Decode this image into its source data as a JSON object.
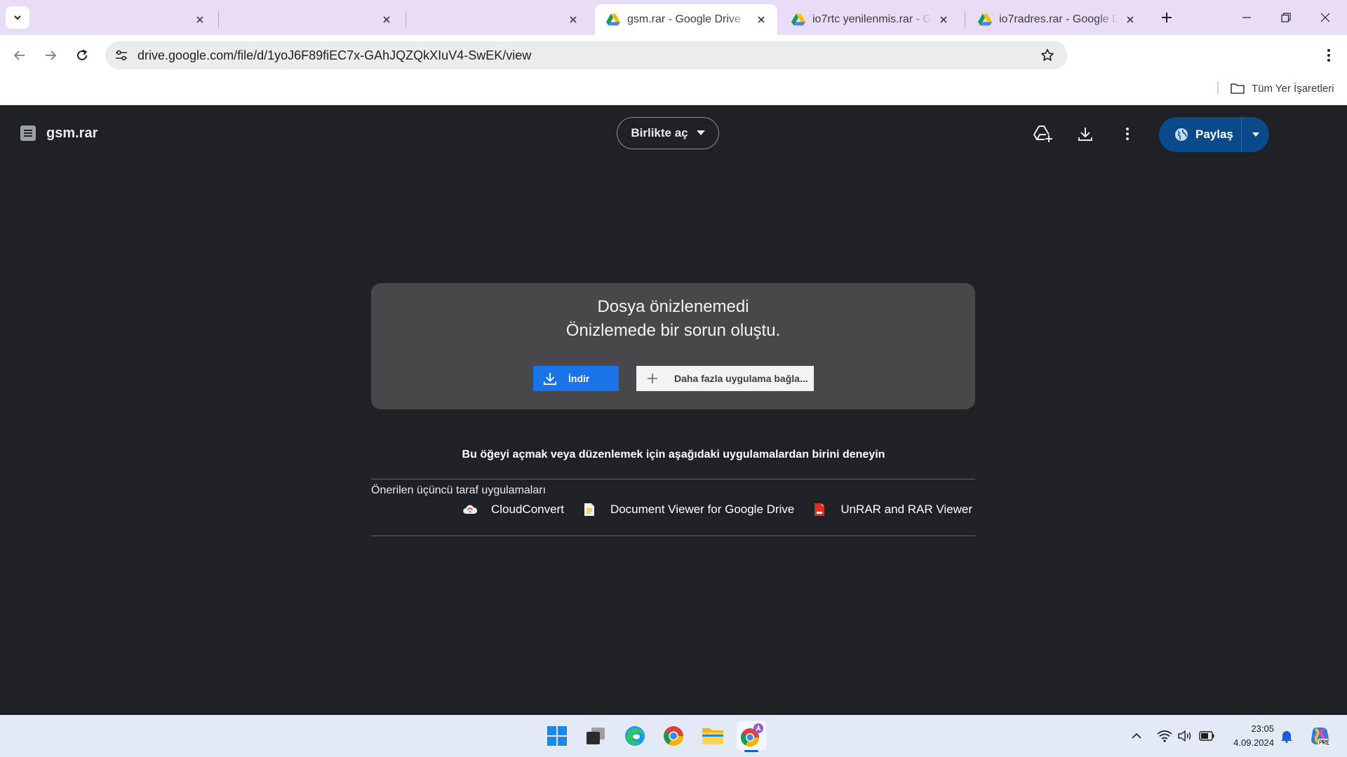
{
  "browser": {
    "tabs": [
      {
        "title": "",
        "active": false,
        "favicon": "none"
      },
      {
        "title": "",
        "active": false,
        "favicon": "none"
      },
      {
        "title": "",
        "active": false,
        "favicon": "none"
      },
      {
        "title": "gsm.rar - Google Drive",
        "active": true,
        "favicon": "google-drive-icon"
      },
      {
        "title": "io7rtc yenilenmis.rar - Google Drive",
        "active": false,
        "favicon": "google-drive-icon"
      },
      {
        "title": "io7radres.rar - Google Drive",
        "active": false,
        "favicon": "google-drive-icon"
      }
    ],
    "url": "drive.google.com/file/d/1yoJ6F89fiEC7x-GAhJQZQkXIuV4-SwEK/view",
    "bookmarks": {
      "all_bookmarks_label": "Tüm Yer İşaretleri"
    }
  },
  "drive": {
    "file_name": "gsm.rar",
    "open_with_label": "Birlikte aç",
    "share_label": "Paylaş",
    "error": {
      "title": "Dosya önizlenemedi",
      "subtitle": "Önizlemede bir sorun oluştu.",
      "download_label": "İndir",
      "connect_label": "Daha fazla uygulama bağla..."
    },
    "try_apps_text": "Bu öğeyi açmak veya düzenlemek için aşağıdaki uygulamalardan birini deneyin",
    "suggested_label": "Önerilen üçüncü taraf uygulamaları",
    "apps": [
      {
        "name": "CloudConvert",
        "icon": "cloudconvert-icon"
      },
      {
        "name": "Document Viewer for Google Drive",
        "icon": "document-viewer-icon"
      },
      {
        "name": "UnRAR and RAR Viewer",
        "icon": "unrar-icon"
      }
    ]
  },
  "taskbar": {
    "apps": [
      "windows-start-icon",
      "task-view-icon",
      "edge-icon",
      "chrome-icon",
      "file-explorer-icon",
      "chrome-profile-icon"
    ],
    "time": "23:05",
    "date": "4.09.2024"
  },
  "colors": {
    "tabstrip": "#e9dcf6",
    "viewer_bg": "#202124",
    "error_card": "#48484a",
    "download_button": "#1a73e8",
    "share_button": "#0b4a8a",
    "taskbar": "#e3eaf5"
  }
}
